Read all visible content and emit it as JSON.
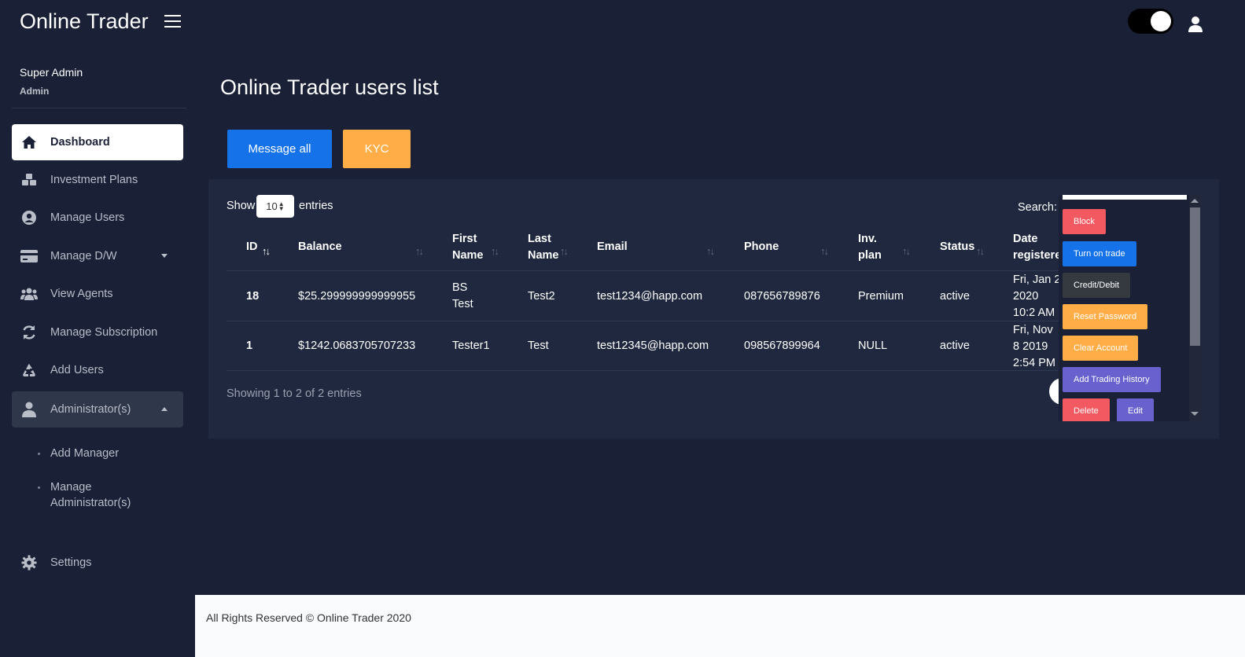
{
  "app": {
    "brand": "Online Trader"
  },
  "sidebar": {
    "profile_name": "Super Admin",
    "profile_role": "Admin",
    "items": [
      {
        "label": "Dashboard",
        "icon": "home-icon"
      },
      {
        "label": "Investment Plans",
        "icon": "cubes-icon"
      },
      {
        "label": "Manage Users",
        "icon": "user-circle-icon"
      },
      {
        "label": "Manage D/W",
        "icon": "credit-card-icon"
      },
      {
        "label": "View Agents",
        "icon": "users-icon"
      },
      {
        "label": "Manage Subscription",
        "icon": "refresh-icon"
      },
      {
        "label": "Add Users",
        "icon": "recycle-icon"
      },
      {
        "label": "Administrator(s)",
        "icon": "user-icon"
      },
      {
        "label": "Settings",
        "icon": "gear-icon"
      }
    ],
    "sub_items": [
      {
        "label": "Add Manager"
      },
      {
        "label": "Manage Administrator(s)"
      }
    ]
  },
  "main": {
    "title": "Online Trader users list",
    "message_all": "Message all",
    "kyc": "KYC",
    "show_label": "Show",
    "entries_value": "10",
    "entries_label": "entries",
    "search_label": "Search:",
    "showing_text": "Showing 1 to 2 of 2 entries"
  },
  "table": {
    "headers": [
      "ID",
      "Balance",
      "First Name",
      "Last Name",
      "Email",
      "Phone",
      "Inv. plan",
      "Status",
      "Date registered"
    ],
    "rows": [
      {
        "id": "18",
        "balance": "$25.299999999999955",
        "first_name": "BS Test",
        "last_name": "Test2",
        "email": "test1234@happ.com",
        "phone": "087656789876",
        "plan": "Premium",
        "status": "active",
        "date": "Fri, Jan 2 2020 10:2 AM"
      },
      {
        "id": "1",
        "balance": "$1242.0683705707233",
        "first_name": "Tester1",
        "last_name": "Test",
        "email": "test12345@happ.com",
        "phone": "098567899964",
        "plan": "NULL",
        "status": "active",
        "date": "Fri, Nov 8 2019 2:54 PM"
      }
    ]
  },
  "actions": {
    "block": "Block",
    "turn_on_trade": "Turn on trade",
    "credit_debit": "Credit/Debit",
    "reset_password": "Reset Password",
    "clear_account": "Clear Account",
    "add_trading_history": "Add Trading History",
    "delete": "Delete",
    "edit": "Edit"
  },
  "footer": {
    "text": "All Rights Reserved © Online Trader 2020"
  },
  "colors": {
    "background": "#1a2035",
    "card": "#1f283e",
    "primary": "#1572e8",
    "warning": "#ffad46",
    "danger": "#f25961",
    "dark": "#343a40",
    "purple": "#6861ce"
  }
}
